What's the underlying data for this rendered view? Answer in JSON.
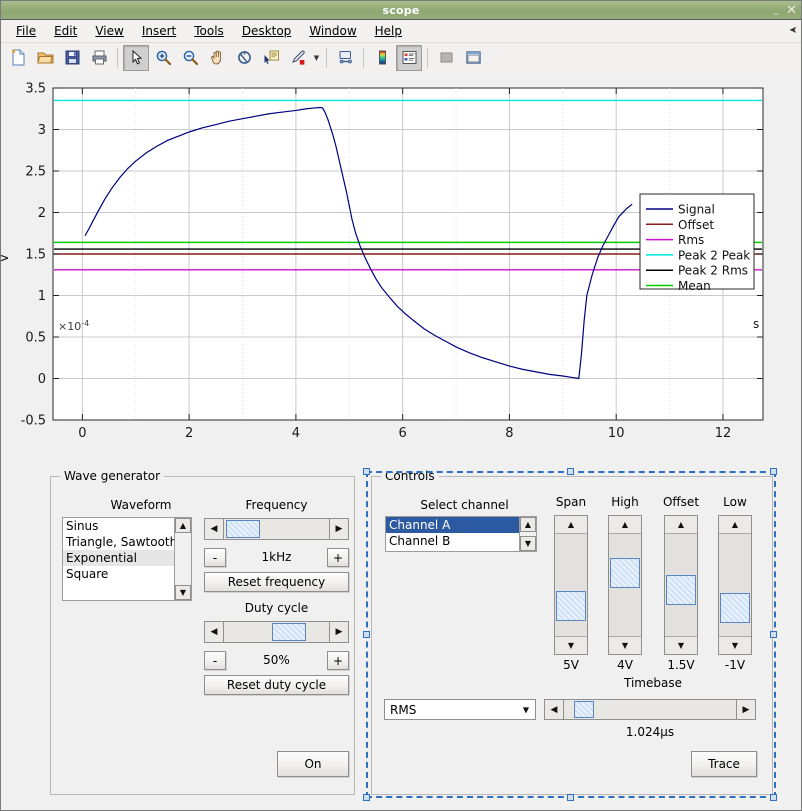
{
  "window": {
    "title": "scope",
    "minimize_label": "–",
    "close_label": "✕"
  },
  "menubar": {
    "items": [
      {
        "label": "File",
        "accel": "F"
      },
      {
        "label": "Edit",
        "accel": "E"
      },
      {
        "label": "View",
        "accel": "V"
      },
      {
        "label": "Insert",
        "accel": "I"
      },
      {
        "label": "Tools",
        "accel": "T"
      },
      {
        "label": "Desktop",
        "accel": "D"
      },
      {
        "label": "Window",
        "accel": "W"
      },
      {
        "label": "Help",
        "accel": "H"
      }
    ],
    "overflow_icon": "overflow-arrow-icon"
  },
  "toolbar": {
    "buttons": [
      {
        "name": "new-figure-icon",
        "tip": "New Figure"
      },
      {
        "name": "open-file-icon",
        "tip": "Open File"
      },
      {
        "name": "save-figure-icon",
        "tip": "Save Figure"
      },
      {
        "name": "print-figure-icon",
        "tip": "Print Figure"
      },
      {
        "name": "pointer-select-icon",
        "tip": "Edit Plot",
        "pressed": true
      },
      {
        "name": "zoom-in-icon",
        "tip": "Zoom In"
      },
      {
        "name": "zoom-out-icon",
        "tip": "Zoom Out"
      },
      {
        "name": "pan-hand-icon",
        "tip": "Pan"
      },
      {
        "name": "rotate-3d-icon",
        "tip": "Rotate 3D"
      },
      {
        "name": "data-cursor-icon",
        "tip": "Data Cursor"
      },
      {
        "name": "brush-icon",
        "tip": "Brush/Select Data"
      },
      {
        "name": "brush-dropdown-caret",
        "tip": "Brush options"
      },
      {
        "name": "link-plot-icon",
        "tip": "Link Plot"
      },
      {
        "name": "colorbar-icon",
        "tip": "Insert Colorbar"
      },
      {
        "name": "legend-icon",
        "tip": "Insert Legend"
      },
      {
        "name": "hide-plot-tools-icon",
        "tip": "Hide Plot Tools"
      },
      {
        "name": "show-plot-tools-icon",
        "tip": "Show Plot Tools and Dock Figure"
      }
    ]
  },
  "chart_data": {
    "type": "line",
    "title": "",
    "xlabel": "s",
    "ylabel": "V",
    "x_exponent_label": "×10",
    "x_exponent_value": "-4",
    "xlim": [
      -0.55,
      12.75
    ],
    "ylim": [
      -0.5,
      3.5
    ],
    "xticks": [
      0,
      2,
      4,
      6,
      8,
      10,
      12
    ],
    "xtick_labels": [
      "0",
      "2",
      "4",
      "6",
      "8",
      "10",
      "12"
    ],
    "yticks": [
      -0.5,
      0,
      0.5,
      1,
      1.5,
      2,
      2.5,
      3,
      3.5
    ],
    "ytick_labels": [
      "-0.5",
      "0",
      "0.5",
      "1",
      "1.5",
      "2",
      "2.5",
      "3",
      "3.5"
    ],
    "grid": true,
    "legend_position": "upper right",
    "series": [
      {
        "name": "Signal",
        "color": "#000080",
        "type": "trace",
        "points": [
          [
            0.05,
            1.72
          ],
          [
            0.12,
            1.8
          ],
          [
            0.2,
            1.9
          ],
          [
            0.3,
            2.02
          ],
          [
            0.42,
            2.16
          ],
          [
            0.55,
            2.29
          ],
          [
            0.7,
            2.42
          ],
          [
            0.85,
            2.53
          ],
          [
            1.0,
            2.62
          ],
          [
            1.2,
            2.72
          ],
          [
            1.4,
            2.8
          ],
          [
            1.6,
            2.87
          ],
          [
            1.8,
            2.92
          ],
          [
            2.0,
            2.97
          ],
          [
            2.25,
            3.02
          ],
          [
            2.5,
            3.06
          ],
          [
            2.75,
            3.1
          ],
          [
            3.0,
            3.13
          ],
          [
            3.25,
            3.16
          ],
          [
            3.5,
            3.19
          ],
          [
            3.75,
            3.21
          ],
          [
            4.0,
            3.23
          ],
          [
            4.2,
            3.25
          ],
          [
            4.35,
            3.26
          ],
          [
            4.45,
            3.265
          ],
          [
            4.5,
            3.26
          ],
          [
            4.55,
            3.2
          ],
          [
            4.6,
            3.12
          ],
          [
            4.65,
            3.02
          ],
          [
            4.7,
            2.92
          ],
          [
            4.75,
            2.8
          ],
          [
            4.8,
            2.66
          ],
          [
            4.85,
            2.52
          ],
          [
            4.9,
            2.38
          ],
          [
            4.95,
            2.24
          ],
          [
            5.0,
            2.08
          ],
          [
            5.05,
            1.92
          ],
          [
            5.12,
            1.75
          ],
          [
            5.2,
            1.6
          ],
          [
            5.3,
            1.45
          ],
          [
            5.4,
            1.32
          ],
          [
            5.5,
            1.2
          ],
          [
            5.6,
            1.1
          ],
          [
            5.75,
            0.98
          ],
          [
            5.9,
            0.87
          ],
          [
            6.05,
            0.78
          ],
          [
            6.2,
            0.7
          ],
          [
            6.4,
            0.6
          ],
          [
            6.6,
            0.52
          ],
          [
            6.8,
            0.45
          ],
          [
            7.0,
            0.38
          ],
          [
            7.25,
            0.31
          ],
          [
            7.5,
            0.25
          ],
          [
            7.75,
            0.2
          ],
          [
            8.0,
            0.15
          ],
          [
            8.25,
            0.11
          ],
          [
            8.5,
            0.08
          ],
          [
            8.75,
            0.05
          ],
          [
            9.0,
            0.03
          ],
          [
            9.2,
            0.01
          ],
          [
            9.3,
            0.0
          ],
          [
            9.35,
            0.3
          ],
          [
            9.4,
            0.7
          ],
          [
            9.45,
            1.0
          ],
          [
            9.55,
            1.25
          ],
          [
            9.65,
            1.45
          ],
          [
            9.75,
            1.6
          ],
          [
            9.85,
            1.72
          ],
          [
            9.95,
            1.84
          ],
          [
            10.05,
            1.95
          ],
          [
            10.2,
            2.05
          ],
          [
            10.3,
            2.1
          ]
        ]
      },
      {
        "name": "Offset",
        "color": "#8b1a1a",
        "type": "hline",
        "value": 1.5
      },
      {
        "name": "Rms",
        "color": "#c814c8",
        "type": "hline",
        "value": 1.31
      },
      {
        "name": "Peak 2 Peak",
        "color": "#00e5e5",
        "type": "hline",
        "value": 3.35
      },
      {
        "name": "Peak 2 Rms",
        "color": "#000000",
        "type": "hline",
        "value": 1.56
      },
      {
        "name": "Mean",
        "color": "#00cc00",
        "type": "hline",
        "value": 1.64
      }
    ]
  },
  "wave_generator": {
    "group_title": "Wave generator",
    "waveform_label": "Waveform",
    "waveform_options": [
      "Sinus",
      "Triangle, Sawtooth",
      "Exponential",
      "Square"
    ],
    "waveform_selected": "Exponential",
    "frequency_label": "Frequency",
    "frequency_value": "1kHz",
    "frequency_minus": "-",
    "frequency_plus": "+",
    "reset_frequency_label": "Reset frequency",
    "duty_cycle_label": "Duty cycle",
    "duty_cycle_value": "50%",
    "duty_minus": "-",
    "duty_plus": "+",
    "reset_duty_label": "Reset duty cycle",
    "on_button_label": "On"
  },
  "controls": {
    "group_title": "Controls",
    "select_channel_label": "Select channel",
    "channel_options": [
      "Channel A",
      "Channel B"
    ],
    "channel_selected": "Channel A",
    "sliders": [
      {
        "label": "Span",
        "value": "5V",
        "thumb_pct": 56
      },
      {
        "label": "High",
        "value": "4V",
        "thumb_pct": 24
      },
      {
        "label": "Offset",
        "value": "1.5V",
        "thumb_pct": 40
      },
      {
        "label": "Low",
        "value": "-1V",
        "thumb_pct": 58
      }
    ],
    "timebase_label": "Timebase",
    "timebase_value": "1.024µs",
    "measurement_selected": "RMS",
    "measurement_options": [
      "RMS"
    ],
    "trace_button_label": "Trace"
  }
}
